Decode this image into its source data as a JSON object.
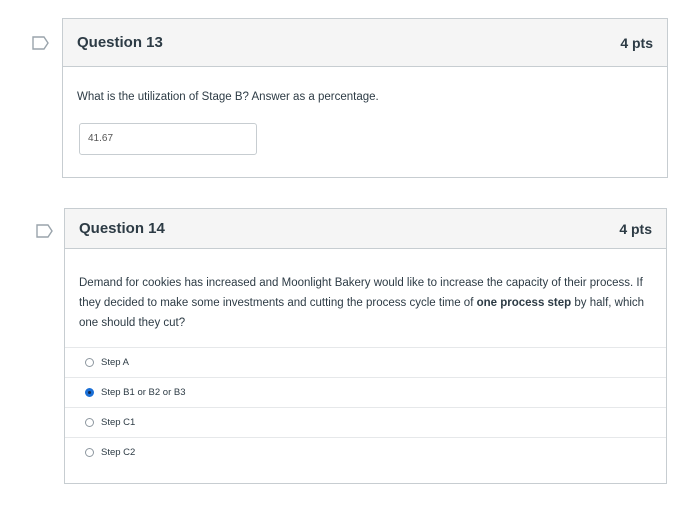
{
  "q13": {
    "title": "Question 13",
    "points": "4 pts",
    "prompt": "What is the utilization of Stage B? Answer as a percentage.",
    "answer_value": "41.67"
  },
  "q14": {
    "title": "Question 14",
    "points": "4 pts",
    "prompt_part1": "Demand for cookies has increased and Moonlight Bakery would like to increase the capacity of their process. If they decided to make some investments and cutting the process cycle time of ",
    "prompt_bold": "one process step",
    "prompt_part2": " by half, which one should they cut?",
    "options": [
      {
        "label": "Step A",
        "selected": false
      },
      {
        "label": "Step B1 or B2 or B3",
        "selected": true
      },
      {
        "label": "Step C1",
        "selected": false
      },
      {
        "label": "Step C2",
        "selected": false
      }
    ]
  },
  "colors": {
    "accent": "#1a6fd6",
    "header_bg": "#f5f5f5",
    "border": "#c7cdd1"
  },
  "icons": {
    "flag": "flag-icon"
  }
}
